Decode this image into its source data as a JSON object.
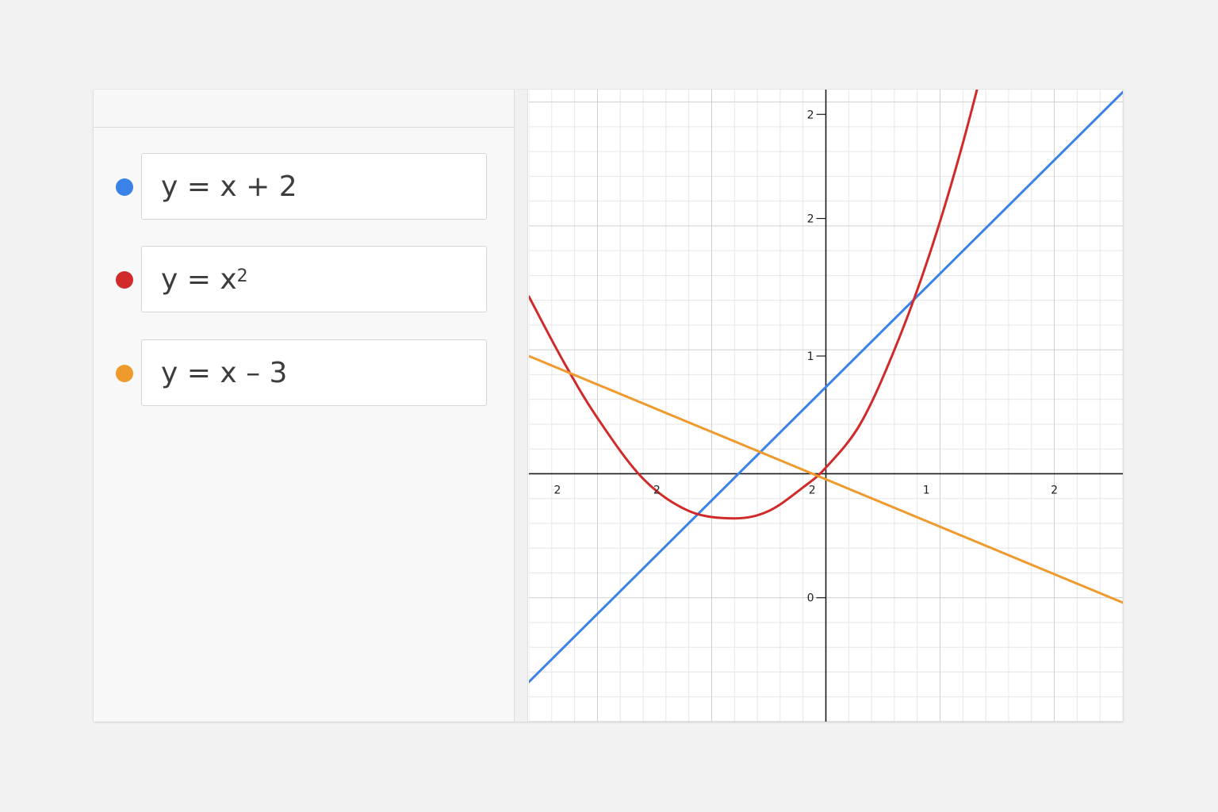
{
  "expressions": [
    {
      "formula": "y = x + 2",
      "base": "y = x + 2",
      "sup": "",
      "color": "#3b82e8"
    },
    {
      "formula": "y = x²",
      "base": "y = x",
      "sup": "2",
      "color": "#d02a2a"
    },
    {
      "formula": "y = x − 3",
      "base": "y = x – 3",
      "sup": "",
      "color": "#ee9a2c"
    }
  ],
  "chart_data": {
    "type": "line",
    "grid": true,
    "xlim": [
      -2.6,
      2.6
    ],
    "ylim": [
      -2.0,
      3.1
    ],
    "series": [
      {
        "color": "#3b82e8",
        "x": [
          -2.6,
          2.6
        ],
        "y": [
          -1.68,
          3.08
        ]
      },
      {
        "color": "#d02a2a",
        "x": [
          -2.6,
          -2.3,
          -2.0,
          -1.6,
          -1.2,
          -0.8,
          -0.5,
          -0.2,
          0.0,
          0.3,
          0.6,
          0.9,
          1.2,
          1.6
        ],
        "y": [
          1.43,
          0.91,
          0.45,
          -0.04,
          -0.3,
          -0.36,
          -0.3,
          -0.11,
          0.05,
          0.4,
          1.0,
          1.75,
          2.67,
          4.1
        ]
      },
      {
        "color": "#ee9a2c",
        "x": [
          -2.6,
          2.6
        ],
        "y": [
          0.95,
          -1.04
        ]
      }
    ],
    "x_ticks": [
      {
        "value": -2.35,
        "label": "2"
      },
      {
        "value": -1.48,
        "label": "2"
      },
      {
        "value": -0.12,
        "label": "2"
      },
      {
        "value": 0.88,
        "label": "1"
      },
      {
        "value": 2.0,
        "label": "2"
      }
    ],
    "y_ticks": [
      {
        "value": 2.9,
        "label": "2"
      },
      {
        "value": 2.06,
        "label": "2"
      },
      {
        "value": 0.95,
        "label": "1"
      },
      {
        "value": -1.0,
        "label": "0"
      }
    ]
  }
}
